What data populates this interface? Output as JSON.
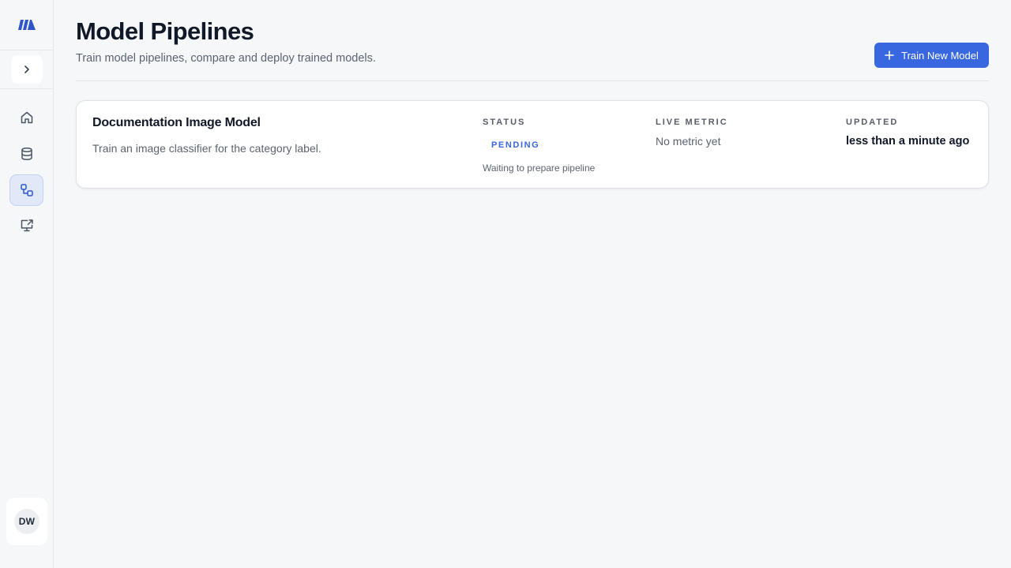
{
  "sidebar": {
    "logo": "brand-logo",
    "expand_icon": "chevron-right-icon",
    "nav": [
      {
        "icon": "home-icon",
        "active": false
      },
      {
        "icon": "database-icon",
        "active": false
      },
      {
        "icon": "pipeline-icon",
        "active": true
      },
      {
        "icon": "deploy-monitor-icon",
        "active": false
      }
    ],
    "user_initials": "DW"
  },
  "header": {
    "title": "Model Pipelines",
    "subtitle": "Train model pipelines, compare and deploy trained models.",
    "primary_button": "Train New Model",
    "primary_icon": "plus-icon"
  },
  "pipelines": [
    {
      "name": "Documentation Image Model",
      "description": "Train an image classifier for the category label.",
      "status_label": "STATUS",
      "status": "PENDING",
      "status_note": "Waiting to prepare pipeline",
      "metric_label": "LIVE METRIC",
      "metric_value": "No metric yet",
      "updated_label": "UPDATED",
      "updated_value": "less than a minute ago"
    }
  ],
  "colors": {
    "accent": "#3867e0",
    "background": "#f6f7f9",
    "card": "#ffffff",
    "active_nav": "#e1e8f7"
  }
}
